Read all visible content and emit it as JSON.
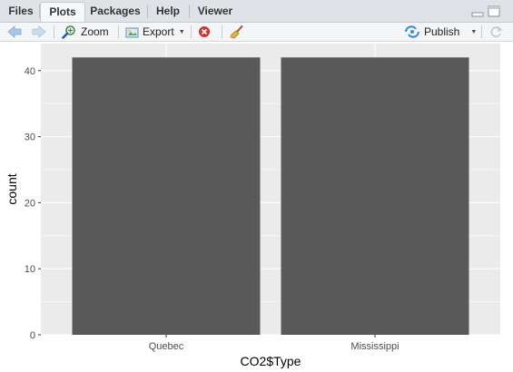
{
  "tabs": [
    {
      "label": "Files",
      "active": false
    },
    {
      "label": "Plots",
      "active": true
    },
    {
      "label": "Packages",
      "active": false
    },
    {
      "label": "Help",
      "active": false
    },
    {
      "label": "Viewer",
      "active": false
    }
  ],
  "toolbar": {
    "zoom_label": "Zoom",
    "export_label": "Export",
    "publish_label": "Publish"
  },
  "icons": {
    "back": "back-arrow-icon",
    "forward": "forward-arrow-icon",
    "zoom": "zoom-icon",
    "export": "export-icon",
    "remove": "remove-plot-icon",
    "clear": "broom-icon",
    "publish": "publish-icon",
    "refresh": "refresh-icon",
    "minimize": "minimize-icon",
    "maximize": "maximize-icon"
  },
  "colors": {
    "panel_background": "#ebebeb",
    "bar_fill": "#595959",
    "gridline": "#ffffff",
    "accent_blue": "#3b8ed6",
    "remove_red": "#d0342c"
  },
  "chart_data": {
    "type": "bar",
    "categories": [
      "Quebec",
      "Mississippi"
    ],
    "values": [
      42,
      42
    ],
    "xlabel": "CO2$Type",
    "ylabel": "count",
    "ylim": [
      0,
      44.1
    ],
    "yticks": [
      0,
      10,
      20,
      30,
      40
    ],
    "grid": true,
    "legend": "none"
  }
}
